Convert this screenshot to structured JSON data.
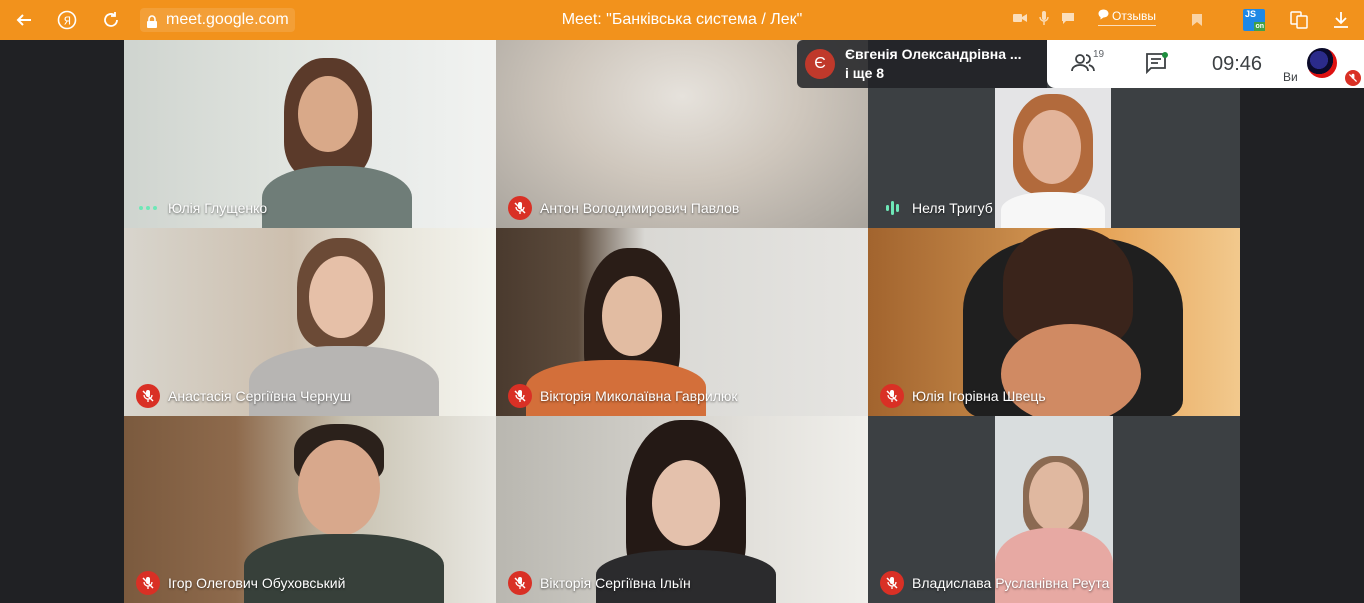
{
  "browser": {
    "address": "meet.google.com",
    "window_title": "Meet: \"Банківська система / Лек\"",
    "reviews_label": "Отзывы",
    "extension_label": "JS",
    "extension_badge": "on"
  },
  "presenter": {
    "avatar_letter": "Є",
    "name": "Євгенія Олександрівна ...",
    "more": "і ще 8"
  },
  "controls": {
    "participants_count": "19",
    "time": "09:46",
    "self_label": "Ви"
  },
  "participants": [
    {
      "name": "Юлія Глущенко",
      "status": "speaking-dots"
    },
    {
      "name": "Антон Володимирович Павлов",
      "status": "muted"
    },
    {
      "name": "Неля Тригуб",
      "status": "speaking-wave"
    },
    {
      "name": "Анастасія Сергіївна Чернуш",
      "status": "muted"
    },
    {
      "name": "Вікторія Миколаївна Гаврилюк",
      "status": "muted"
    },
    {
      "name": "Юлія Ігорівна Швець",
      "status": "muted"
    },
    {
      "name": "Ігор Олегович Обуховський",
      "status": "muted"
    },
    {
      "name": "Вікторія Сергіївна Ільїн",
      "status": "muted"
    },
    {
      "name": "Владислава Русланівна Реута",
      "status": "muted"
    }
  ],
  "colors": {
    "topbar": "#f2921c",
    "mute": "#d93025",
    "background": "#202124"
  }
}
